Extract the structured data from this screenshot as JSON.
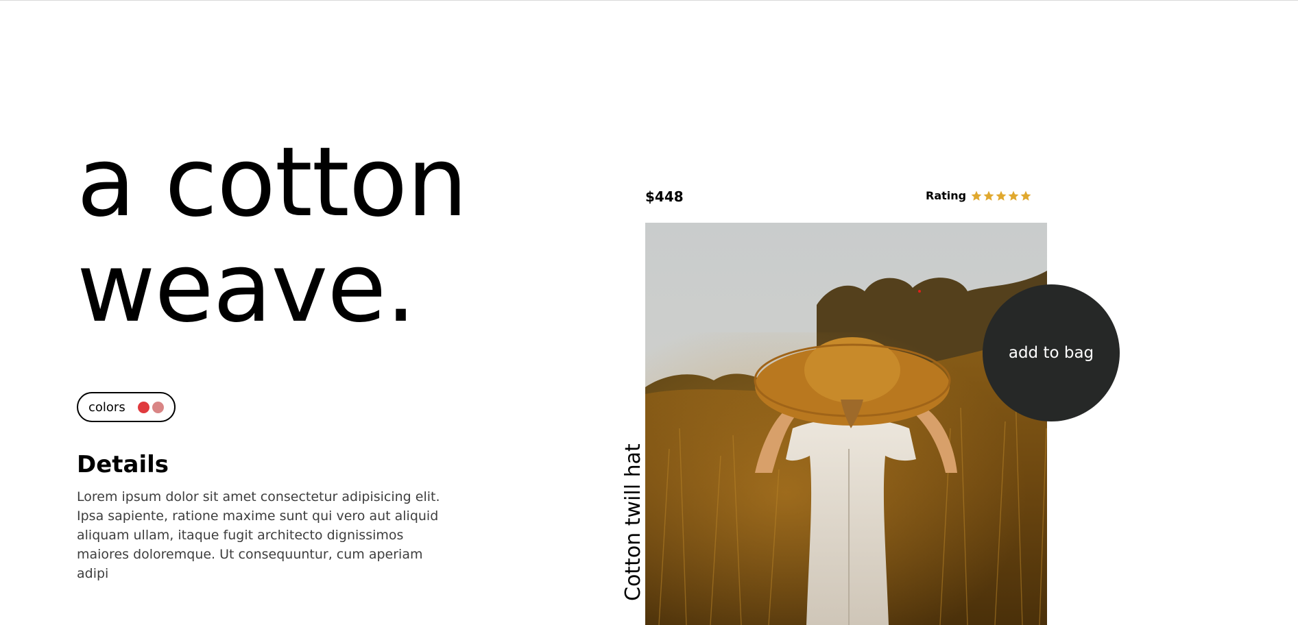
{
  "hero": {
    "line1": "a cotton",
    "line2": "weave."
  },
  "colors": {
    "label": "colors",
    "swatches": [
      "#e03a3e",
      "#d98585"
    ]
  },
  "details": {
    "title": "Details",
    "body": "Lorem ipsum dolor sit amet consectetur adipisicing elit. Ipsa sapiente, ratione maxime sunt qui vero aut aliquid aliquam ullam, itaque fugit architecto dignissimos maiores doloremque. Ut consequuntur, cum aperiam adipi"
  },
  "product": {
    "price": "$448",
    "rating_label": "Rating",
    "rating_value": 5,
    "rating_max": 5,
    "star_color": "#e0a82e",
    "name": "Cotton twill hat",
    "image_icon": "woman-in-straw-hat-field-photo"
  },
  "actions": {
    "add_to_bag": "add to bag"
  }
}
